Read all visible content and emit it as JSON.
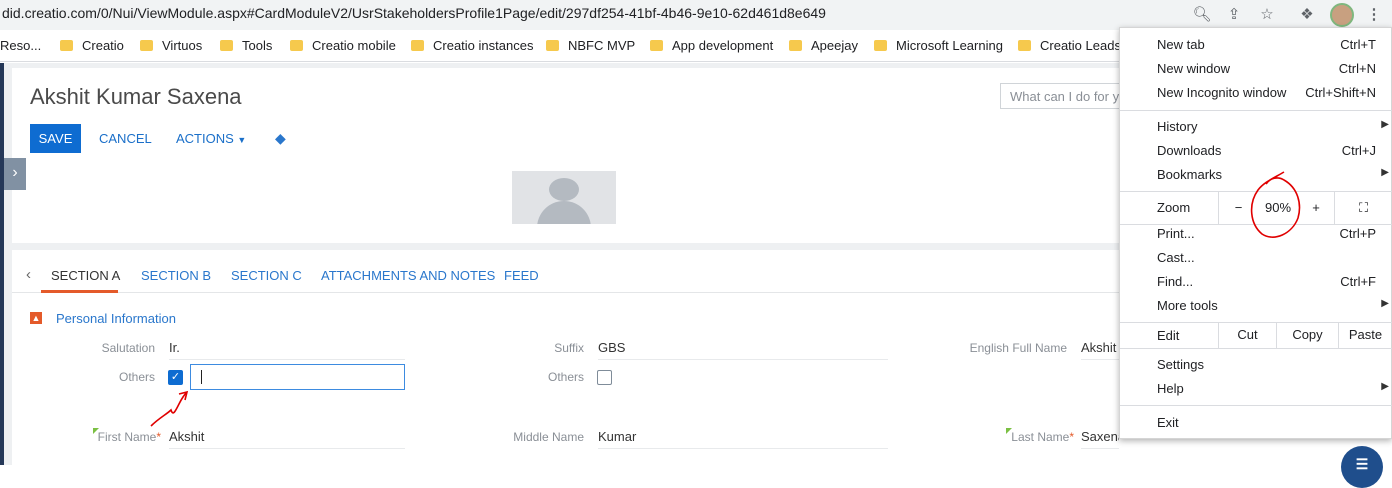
{
  "browser": {
    "url": "did.creatio.com/0/Nui/ViewModule.aspx#CardModuleV2/UsrStakeholdersProfile1Page/edit/297df254-41bf-4b46-9e10-62d461d8e649",
    "bookmarks": [
      "Reso...",
      "Creatio",
      "Virtuos",
      "Tools",
      "Creatio mobile",
      "Creatio instances",
      "NBFC MVP",
      "App development",
      "Apeejay",
      "Microsoft Learning",
      "Creatio Leads"
    ]
  },
  "page": {
    "title": "Akshit Kumar Saxena",
    "save_label": "SAVE",
    "cancel_label": "CANCEL",
    "actions_label": "ACTIONS",
    "search_placeholder": "What can I do for yo"
  },
  "tabs": [
    "SECTION A",
    "SECTION B",
    "SECTION C",
    "ATTACHMENTS AND NOTES",
    "FEED"
  ],
  "section": {
    "title": "Personal Information",
    "fields": {
      "salutation_label": "Salutation",
      "salutation_value": "Ir.",
      "suffix_label": "Suffix",
      "suffix_value": "GBS",
      "english_full_name_label": "English Full Name",
      "english_full_name_value": "Akshit",
      "others_label": "Others",
      "others_left_checked": true,
      "others_right_checked": false,
      "first_name_label": "First Name",
      "first_name_value": "Akshit",
      "middle_name_label": "Middle Name",
      "middle_name_value": "Kumar",
      "last_name_label": "Last Name",
      "last_name_value": "Saxena",
      "required_mark": "*"
    }
  },
  "chrome_menu": {
    "new_tab": "New tab",
    "new_tab_sc": "Ctrl+T",
    "new_window": "New window",
    "new_window_sc": "Ctrl+N",
    "new_incognito": "New Incognito window",
    "new_incognito_sc": "Ctrl+Shift+N",
    "history": "History",
    "downloads": "Downloads",
    "downloads_sc": "Ctrl+J",
    "bookmarks": "Bookmarks",
    "zoom": "Zoom",
    "zoom_minus": "−",
    "zoom_value": "90%",
    "zoom_plus": "+",
    "print": "Print...",
    "print_sc": "Ctrl+P",
    "cast": "Cast...",
    "find": "Find...",
    "find_sc": "Ctrl+F",
    "more_tools": "More tools",
    "edit": "Edit",
    "cut": "Cut",
    "copy": "Copy",
    "paste": "Paste",
    "settings": "Settings",
    "help": "Help",
    "exit": "Exit"
  },
  "colors": {
    "accent_blue": "#0e6cd1",
    "accent_orange": "#e45a2a",
    "annotation_red": "#e00000"
  }
}
